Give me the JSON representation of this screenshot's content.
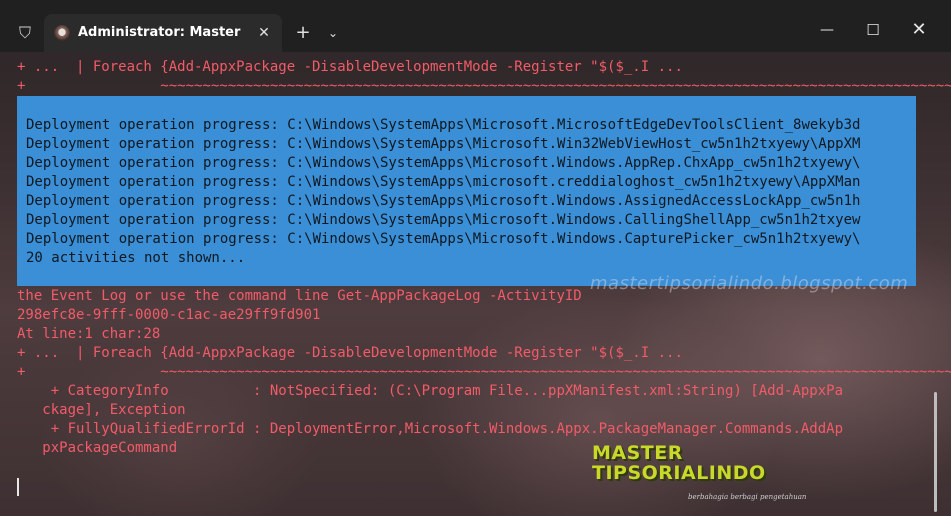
{
  "titlebar": {
    "tab_title": "Administrator: Master PowerS",
    "tab_close_glyph": "✕",
    "new_tab_glyph": "+",
    "dropdown_glyph": "⌄",
    "minimize_glyph": "—",
    "maximize_glyph": "☐",
    "close_glyph": "✕",
    "shield_glyph": "⛉"
  },
  "terminal": {
    "top_lines": [
      "+ ...  | Foreach {Add-AppxPackage -DisableDevelopmentMode -Register \"$($_.I ...",
      "+                ~~~~~~~~~~~~~~~~~~~~~~~~~~~~~~~~~~~~~~~~~~~~~~~~~~~~~~~~~~~~~~~~~~~~~~~~~~~~~~~~~~~~~~~~~~~~~~~~~~~~~~~~~~~~~~~~~~~~~~~~~~~~~~~~~~~~~~~~~~~~~~~~~~~~~~~~~~~~~~~~~~~~~~~~"
    ],
    "progress_lines": [
      "Deployment operation progress: C:\\Windows\\SystemApps\\Microsoft.MicrosoftEdgeDevToolsClient_8wekyb3d",
      "Deployment operation progress: C:\\Windows\\SystemApps\\Microsoft.Win32WebViewHost_cw5n1h2txyewy\\AppXM",
      "Deployment operation progress: C:\\Windows\\SystemApps\\Microsoft.Windows.AppRep.ChxApp_cw5n1h2txyewy\\",
      "Deployment operation progress: C:\\Windows\\SystemApps\\microsoft.creddialoghost_cw5n1h2txyewy\\AppXMan",
      "Deployment operation progress: C:\\Windows\\SystemApps\\Microsoft.Windows.AssignedAccessLockApp_cw5n1h",
      "Deployment operation progress: C:\\Windows\\SystemApps\\Microsoft.Windows.CallingShellApp_cw5n1h2txyew",
      "Deployment operation progress: C:\\Windows\\SystemApps\\Microsoft.Windows.CapturePicker_cw5n1h2txyewy\\",
      "20 activities not shown..."
    ],
    "error_lines": [
      "the Event Log or use the command line Get-AppPackageLog -ActivityID",
      "298efc8e-9fff-0000-c1ac-ae29ff9fd901",
      "At line:1 char:28",
      "+ ...  | Foreach {Add-AppxPackage -DisableDevelopmentMode -Register \"$($_.I ...",
      "+                ~~~~~~~~~~~~~~~~~~~~~~~~~~~~~~~~~~~~~~~~~~~~~~~~~~~~~~~~~~~~~~~~~~~~~~~~~~~~~~~~~~~~~~~~~~~~~~~~~~~~~~~~~~~~~~~~~~~~~~~~~~~~~~~~~~~~~~~~~~~~~~~~~~~~~~~~~~~~~~~~~~~~~~~~",
      "    + CategoryInfo          : NotSpecified: (C:\\Program File...ppXManifest.xml:String) [Add-AppxPa",
      "   ckage], Exception",
      "    + FullyQualifiedErrorId : DeploymentError,Microsoft.Windows.Appx.PackageManager.Commands.AddAp",
      "   pxPackageCommand"
    ]
  },
  "watermark": {
    "url": "mastertipsorialindo.blogspot.com",
    "logo_line1": "MASTER",
    "logo_line2": "TIPSORIALINDO",
    "tagline": "berbahagia berbagi pengetahuan"
  }
}
